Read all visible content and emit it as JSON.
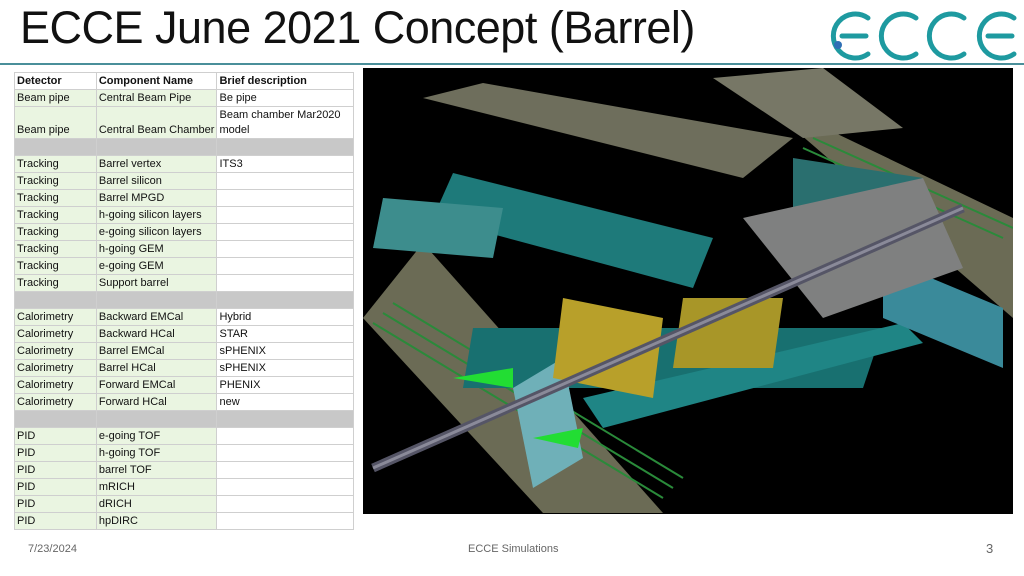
{
  "slide": {
    "title": "ECCE June 2021 Concept (Barrel)",
    "logo_text": "ECCE",
    "accent_color": "#1e9aa0",
    "rule_color": "#4a8f9a"
  },
  "table": {
    "headers": [
      "Detector",
      "Component Name",
      "Brief description"
    ],
    "rows": [
      {
        "detector": "Beam pipe",
        "component": "Central Beam Pipe",
        "desc": "Be pipe"
      },
      {
        "detector": "Beam pipe",
        "component": "Central Beam Chamber",
        "desc": "Beam chamber Mar2020 model"
      },
      {
        "separator": true
      },
      {
        "detector": "Tracking",
        "component": "Barrel vertex",
        "desc": "ITS3"
      },
      {
        "detector": "Tracking",
        "component": "Barrel silicon",
        "desc": ""
      },
      {
        "detector": "Tracking",
        "component": "Barrel MPGD",
        "desc": ""
      },
      {
        "detector": "Tracking",
        "component": "h-going silicon layers",
        "desc": ""
      },
      {
        "detector": "Tracking",
        "component": "e-going silicon layers",
        "desc": ""
      },
      {
        "detector": "Tracking",
        "component": "h-going GEM",
        "desc": ""
      },
      {
        "detector": "Tracking",
        "component": "e-going GEM",
        "desc": ""
      },
      {
        "detector": "Tracking",
        "component": "Support barrel",
        "desc": ""
      },
      {
        "separator": true
      },
      {
        "detector": "Calorimetry",
        "component": "Backward EMCal",
        "desc": "Hybrid"
      },
      {
        "detector": "Calorimetry",
        "component": "Backward HCal",
        "desc": "STAR"
      },
      {
        "detector": "Calorimetry",
        "component": "Barrel EMCal",
        "desc": "sPHENIX"
      },
      {
        "detector": "Calorimetry",
        "component": "Barrel HCal",
        "desc": "sPHENIX"
      },
      {
        "detector": "Calorimetry",
        "component": "Forward EMCal",
        "desc": "PHENIX"
      },
      {
        "detector": "Calorimetry",
        "component": "Forward HCal",
        "desc": "new"
      },
      {
        "separator": true
      },
      {
        "detector": "PID",
        "component": "e-going TOF",
        "desc": ""
      },
      {
        "detector": "PID",
        "component": "h-going TOF",
        "desc": ""
      },
      {
        "detector": "PID",
        "component": "barrel TOF",
        "desc": ""
      },
      {
        "detector": "PID",
        "component": "mRICH",
        "desc": ""
      },
      {
        "detector": "PID",
        "component": "dRICH",
        "desc": ""
      },
      {
        "detector": "PID",
        "component": "hpDIRC",
        "desc": ""
      }
    ]
  },
  "footer": {
    "date": "7/23/2024",
    "center": "ECCE Simulations",
    "page": "3"
  }
}
